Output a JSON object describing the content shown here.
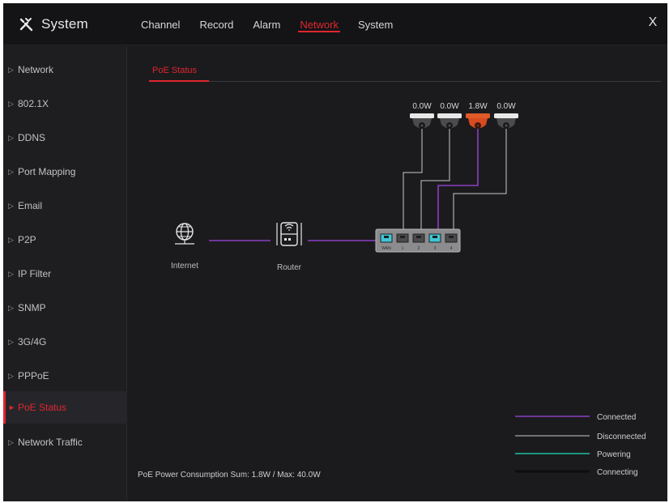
{
  "app": {
    "title": "System"
  },
  "tabs": [
    {
      "label": "Channel"
    },
    {
      "label": "Record"
    },
    {
      "label": "Alarm"
    },
    {
      "label": "Network",
      "active": true
    },
    {
      "label": "System"
    }
  ],
  "close_label": "X",
  "sidebar": {
    "items": [
      {
        "label": "Network"
      },
      {
        "label": "802.1X"
      },
      {
        "label": "DDNS"
      },
      {
        "label": "Port Mapping"
      },
      {
        "label": "Email"
      },
      {
        "label": "P2P"
      },
      {
        "label": "IP Filter"
      },
      {
        "label": "SNMP"
      },
      {
        "label": "3G/4G"
      },
      {
        "label": "PPPoE"
      },
      {
        "label": "PoE Status",
        "active": true
      },
      {
        "label": "Network Traffic"
      }
    ]
  },
  "subtab": {
    "label": "PoE Status"
  },
  "diagram": {
    "internet_label": "Internet",
    "router_label": "Router",
    "switch": {
      "wan_label": "WAN",
      "ports": [
        "1",
        "2",
        "3",
        "4"
      ]
    },
    "cameras": [
      {
        "power": "0.0W",
        "status": "disconnected"
      },
      {
        "power": "0.0W",
        "status": "disconnected"
      },
      {
        "power": "1.8W",
        "status": "connected"
      },
      {
        "power": "0.0W",
        "status": "disconnected"
      }
    ]
  },
  "legend": [
    {
      "label": "Connected",
      "color": "#8a3fc4"
    },
    {
      "label": "Disconnected",
      "color": "#c8c8c8"
    },
    {
      "label": "Powering",
      "color": "#20c0a0"
    },
    {
      "label": "Connecting",
      "color": "#111113"
    }
  ],
  "footer": {
    "power_text": "PoE Power Consumption Sum: 1.8W / Max: 40.0W"
  },
  "colors": {
    "accent": "#e0262e",
    "connected": "#8a3fc4",
    "disconnected": "#c8c8c8",
    "port_active": "#3fc6d8"
  }
}
